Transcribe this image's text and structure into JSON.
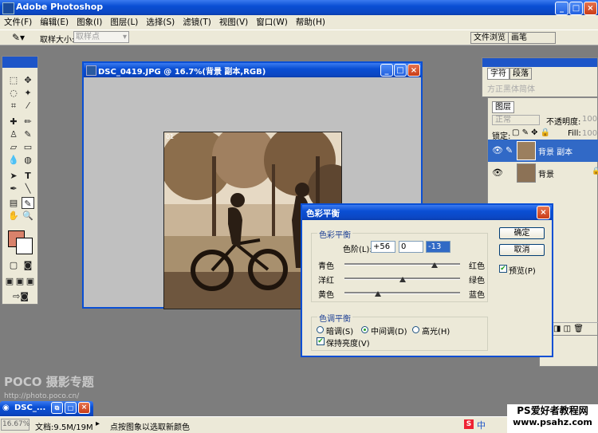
{
  "app": {
    "title": "Adobe Photoshop",
    "title_controls": [
      "_",
      "□",
      "×"
    ]
  },
  "menu": [
    "文件(F)",
    "编辑(E)",
    "图象(I)",
    "图层(L)",
    "选择(S)",
    "滤镜(T)",
    "视图(V)",
    "窗口(W)",
    "帮助(H)"
  ],
  "options_bar": {
    "sample_label": "取样大小:",
    "sample_value": "取样点",
    "tabs": [
      "文件浏览",
      "画笔"
    ]
  },
  "document": {
    "title": "DSC_0419.JPG @ 16.7%(背景 副本,RGB)",
    "corner_label": "01"
  },
  "character_panel": {
    "tabs": [
      "字符",
      "段落"
    ],
    "font": "方正黑体简体"
  },
  "layers_panel": {
    "tab": "图层",
    "blend_mode": "正常",
    "opacity_label": "不透明度:",
    "opacity_value": "100%",
    "lock_label": "锁定:",
    "fill_label": "Fill:",
    "fill_value": "100%",
    "layers": [
      {
        "name": "背景 副本",
        "selected": true
      },
      {
        "name": "背景",
        "selected": false
      }
    ]
  },
  "dialog": {
    "title": "色彩平衡",
    "group1": "色彩平衡",
    "levels_label": "色阶(L):",
    "levels": [
      "+56",
      "0",
      "-13"
    ],
    "sliders": [
      {
        "left": "青色",
        "right": "红色",
        "value": 56
      },
      {
        "left": "洋红",
        "right": "绿色",
        "value": 0
      },
      {
        "left": "黄色",
        "right": "蓝色",
        "value": -13
      }
    ],
    "group2": "色调平衡",
    "tones": [
      "暗调(S)",
      "中间调(D)",
      "高光(H)"
    ],
    "selected_tone": "中间调(D)",
    "preserve_luminosity": "保持亮度(V)",
    "ok": "确定",
    "cancel": "取消",
    "preview": "预览(P)"
  },
  "minimized": {
    "label": "DSC_..."
  },
  "watermark": {
    "brand": "POCO 摄影专题",
    "url": "http://photo.poco.cn/"
  },
  "status": {
    "zoom": "16.67%",
    "doc": "文档:9.5M/19M",
    "hint": "点按图象以选取新颜色"
  },
  "site_watermark": {
    "line1": "PS爱好者教程网",
    "line2": "www.psahz.com"
  },
  "ime": {
    "s_icon": "S",
    "lang": "中"
  },
  "colors": {
    "foreground": "#d9826b",
    "background": "#ffffff",
    "xp_blue": "#0a4fd4"
  }
}
